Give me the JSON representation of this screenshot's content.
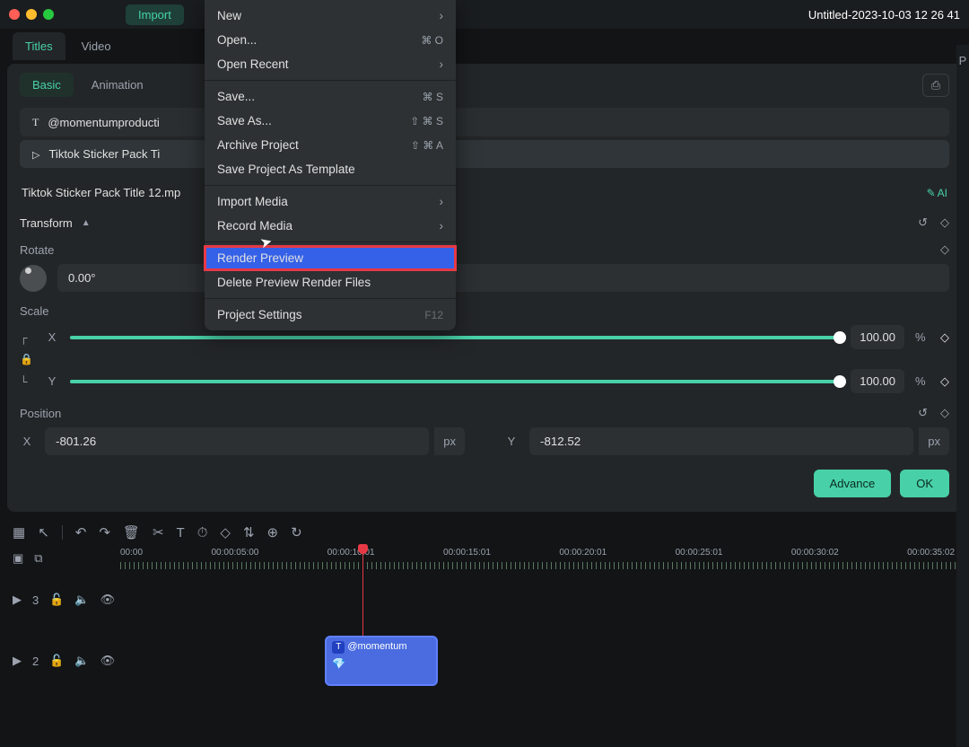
{
  "titlebar": {
    "import_label": "Import",
    "document_title": "Untitled-2023-10-03 12 26 41"
  },
  "top_tabs": [
    "Titles",
    "Video"
  ],
  "sub_tabs": [
    "Basic",
    "Animation"
  ],
  "items": [
    {
      "icon": "T",
      "label": "@momentumproducti"
    },
    {
      "icon": "play",
      "label": "Tiktok Sticker Pack Ti"
    }
  ],
  "filename": "Tiktok Sticker Pack Title 12.mp",
  "ai_label": "AI",
  "transform": {
    "header": "Transform",
    "rotate_label": "Rotate",
    "rotate_value": "0.00°",
    "scale_label": "Scale",
    "scale_x_axis": "X",
    "scale_y_axis": "Y",
    "scale_x_value": "100.00",
    "scale_y_value": "100.00",
    "scale_unit": "%",
    "position_label": "Position",
    "position_x_axis": "X",
    "position_y_axis": "Y",
    "position_x_value": "-801.26",
    "position_y_value": "-812.52",
    "position_unit": "px"
  },
  "buttons": {
    "advance": "Advance",
    "ok": "OK"
  },
  "timeline": {
    "ruler_labels": [
      "00:00",
      "00:00:05:00",
      "00:00:10:01",
      "00:00:15:01",
      "00:00:20:01",
      "00:00:25:01",
      "00:00:30:02",
      "00:00:35:02"
    ],
    "tracks": [
      {
        "num": "3"
      },
      {
        "num": "2"
      }
    ],
    "clip_label": "@momentum",
    "clip_t": "T"
  },
  "menu": {
    "items": [
      {
        "label": "New",
        "arrow": true
      },
      {
        "label": "Open...",
        "shortcut": "⌘ O"
      },
      {
        "label": "Open Recent",
        "arrow": true
      },
      {
        "sep": true
      },
      {
        "label": "Save...",
        "shortcut": "⌘ S"
      },
      {
        "label": "Save As...",
        "shortcut": "⇧ ⌘ S"
      },
      {
        "label": "Archive Project",
        "shortcut": "⇧ ⌘ A"
      },
      {
        "label": "Save Project As Template"
      },
      {
        "sep": true
      },
      {
        "label": "Import Media",
        "arrow": true
      },
      {
        "label": "Record Media",
        "arrow": true
      },
      {
        "sep": true
      },
      {
        "label": "Render Preview",
        "highlight": true
      },
      {
        "label": "Delete Preview Render Files"
      },
      {
        "sep": true
      },
      {
        "label": "Project Settings",
        "shortcut": "F12",
        "dim_shortcut": true
      }
    ]
  },
  "right_edge": "P"
}
